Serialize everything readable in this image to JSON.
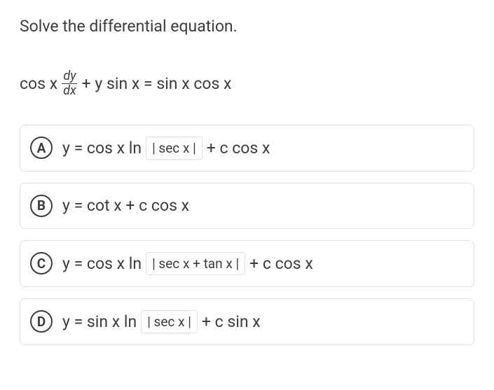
{
  "prompt": "Solve the differential equation.",
  "equation": {
    "pre": "cos x",
    "frac_num": "dy",
    "frac_den": "dx",
    "post": "+ y sin x = sin x cos x"
  },
  "choices": [
    {
      "letter": "A",
      "part1": "y = cos x ln",
      "abs": "| sec x |",
      "part2": "+ c cos x"
    },
    {
      "letter": "B",
      "part1": "y = cot x + c cos x",
      "abs": "",
      "part2": ""
    },
    {
      "letter": "C",
      "part1": "y = cos x ln",
      "abs": "| sec x + tan x |",
      "part2": "+ c cos x"
    },
    {
      "letter": "D",
      "part1": "y = sin x ln",
      "abs": "| sec x |",
      "part2": "+ c sin x"
    }
  ]
}
